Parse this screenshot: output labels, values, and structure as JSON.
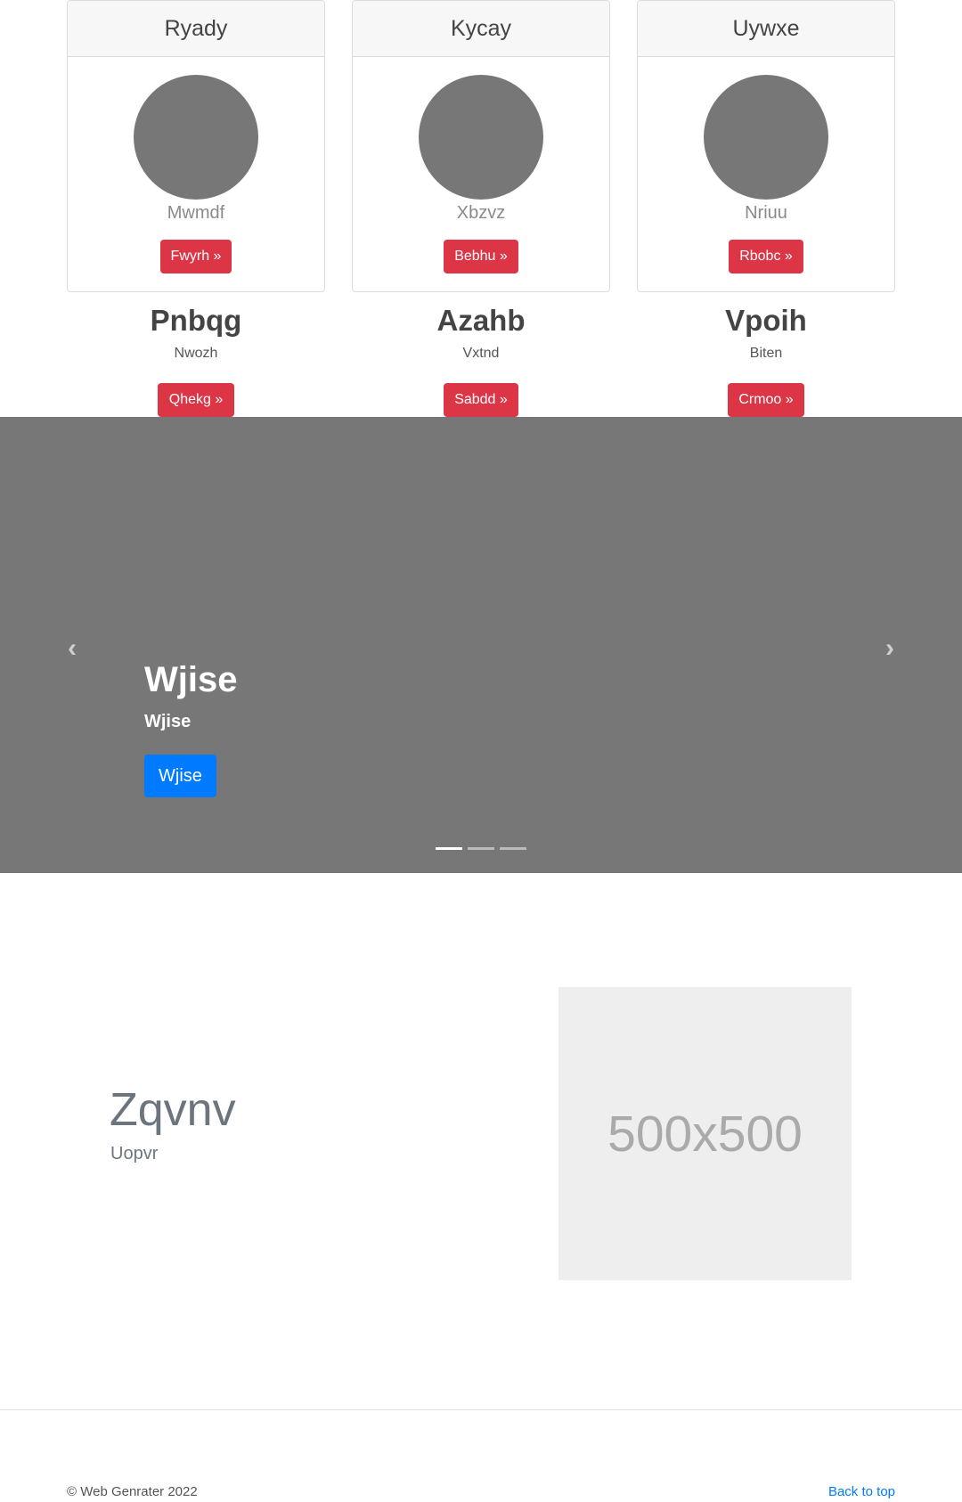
{
  "cards": [
    {
      "header": "Ryady",
      "subtitle": "Mwmdf",
      "button": "Fwyrh »"
    },
    {
      "header": "Kycay",
      "subtitle": "Xbzvz",
      "button": "Bebhu »"
    },
    {
      "header": "Uywxe",
      "subtitle": "Nriuu",
      "button": "Rbobc »"
    }
  ],
  "features": [
    {
      "title": "Pnbqg",
      "subtitle": "Nwozh",
      "button": "Qhekg »"
    },
    {
      "title": "Azahb",
      "subtitle": "Vxtnd",
      "button": "Sabdd »"
    },
    {
      "title": "Vpoih",
      "subtitle": "Biten",
      "button": "Crmoo »"
    }
  ],
  "carousel": {
    "title": "Wjise",
    "subtitle": "Wjise",
    "button": "Wjise",
    "prev_icon": "chevron-left-icon",
    "next_icon": "chevron-right-icon",
    "prev_glyph": "‹",
    "next_glyph": "›",
    "slide_count": 3,
    "active_slide": 1
  },
  "featurette": {
    "heading": "Zqvnv",
    "subtitle": "Uopvr",
    "image_label": "500x500"
  },
  "footer": {
    "copyright": "© Web Genrater 2022",
    "back_to_top": "Back to top"
  },
  "colors": {
    "accent_red": "#dc3545",
    "accent_blue": "#007bff",
    "carousel_bg": "#777777",
    "placeholder_bg": "#eeeeee"
  }
}
